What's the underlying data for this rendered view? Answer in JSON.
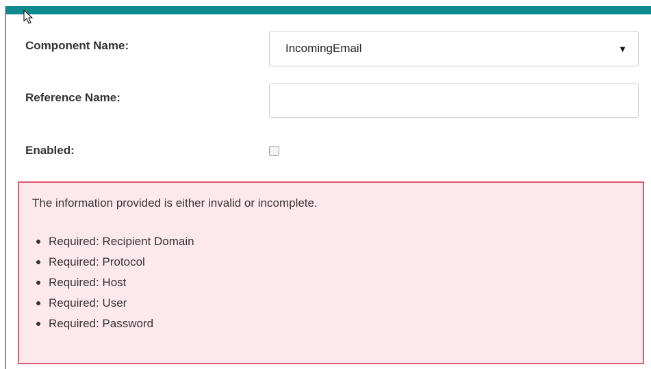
{
  "form": {
    "component_name_label": "Component Name:",
    "component_name_value": "IncomingEmail",
    "reference_name_label": "Reference Name:",
    "reference_name_value": "",
    "enabled_label": "Enabled:",
    "enabled_checked": false
  },
  "error": {
    "message": "The information provided is either invalid or incomplete.",
    "items": [
      "Required: Recipient Domain",
      "Required: Protocol",
      "Required: Host",
      "Required: User",
      "Required: Password"
    ]
  },
  "colors": {
    "header_teal": "#0e8a8f",
    "error_border": "#e0566b",
    "error_background": "#fde9ec"
  },
  "icons": {
    "cursor": "mouse-pointer-icon",
    "select_caret": "caret-down-icon"
  }
}
